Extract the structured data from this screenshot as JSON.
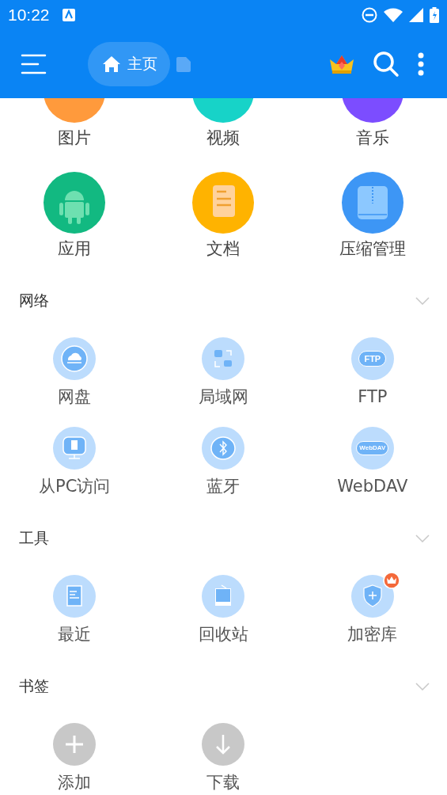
{
  "status_bar": {
    "time": "10:22"
  },
  "app_bar": {
    "breadcrumbs": [
      {
        "label": "主页",
        "selected": true
      }
    ]
  },
  "categories": [
    {
      "label": "图片",
      "kind": "image",
      "color": "#ff9a3c"
    },
    {
      "label": "视频",
      "kind": "video",
      "color": "#17d3c8"
    },
    {
      "label": "音乐",
      "kind": "music",
      "color": "#7c4dff"
    },
    {
      "label": "应用",
      "kind": "app",
      "color": "#12b981"
    },
    {
      "label": "文档",
      "kind": "doc",
      "color": "#ffb300"
    },
    {
      "label": "压缩管理",
      "kind": "zip",
      "color": "#3d96f5"
    }
  ],
  "sections": [
    {
      "title": "网络",
      "items": [
        {
          "label": "网盘",
          "kind": "cloud",
          "premium": false
        },
        {
          "label": "局域网",
          "kind": "lan",
          "premium": false
        },
        {
          "label": "FTP",
          "kind": "tag",
          "icon_text": "FTP",
          "premium": false
        },
        {
          "label": "从PC访问",
          "kind": "pc",
          "premium": false
        },
        {
          "label": "蓝牙",
          "kind": "bluetooth",
          "premium": false
        },
        {
          "label": "WebDAV",
          "kind": "tag",
          "icon_text": "WebDAV",
          "premium": false
        }
      ]
    },
    {
      "title": "工具",
      "items": [
        {
          "label": "最近",
          "kind": "recent",
          "premium": false
        },
        {
          "label": "回收站",
          "kind": "trash",
          "premium": false
        },
        {
          "label": "加密库",
          "kind": "vault",
          "premium": true
        }
      ]
    },
    {
      "title": "书签",
      "items": [
        {
          "label": "添加",
          "kind": "add",
          "premium": false
        },
        {
          "label": "下载",
          "kind": "download",
          "premium": false
        }
      ]
    }
  ]
}
